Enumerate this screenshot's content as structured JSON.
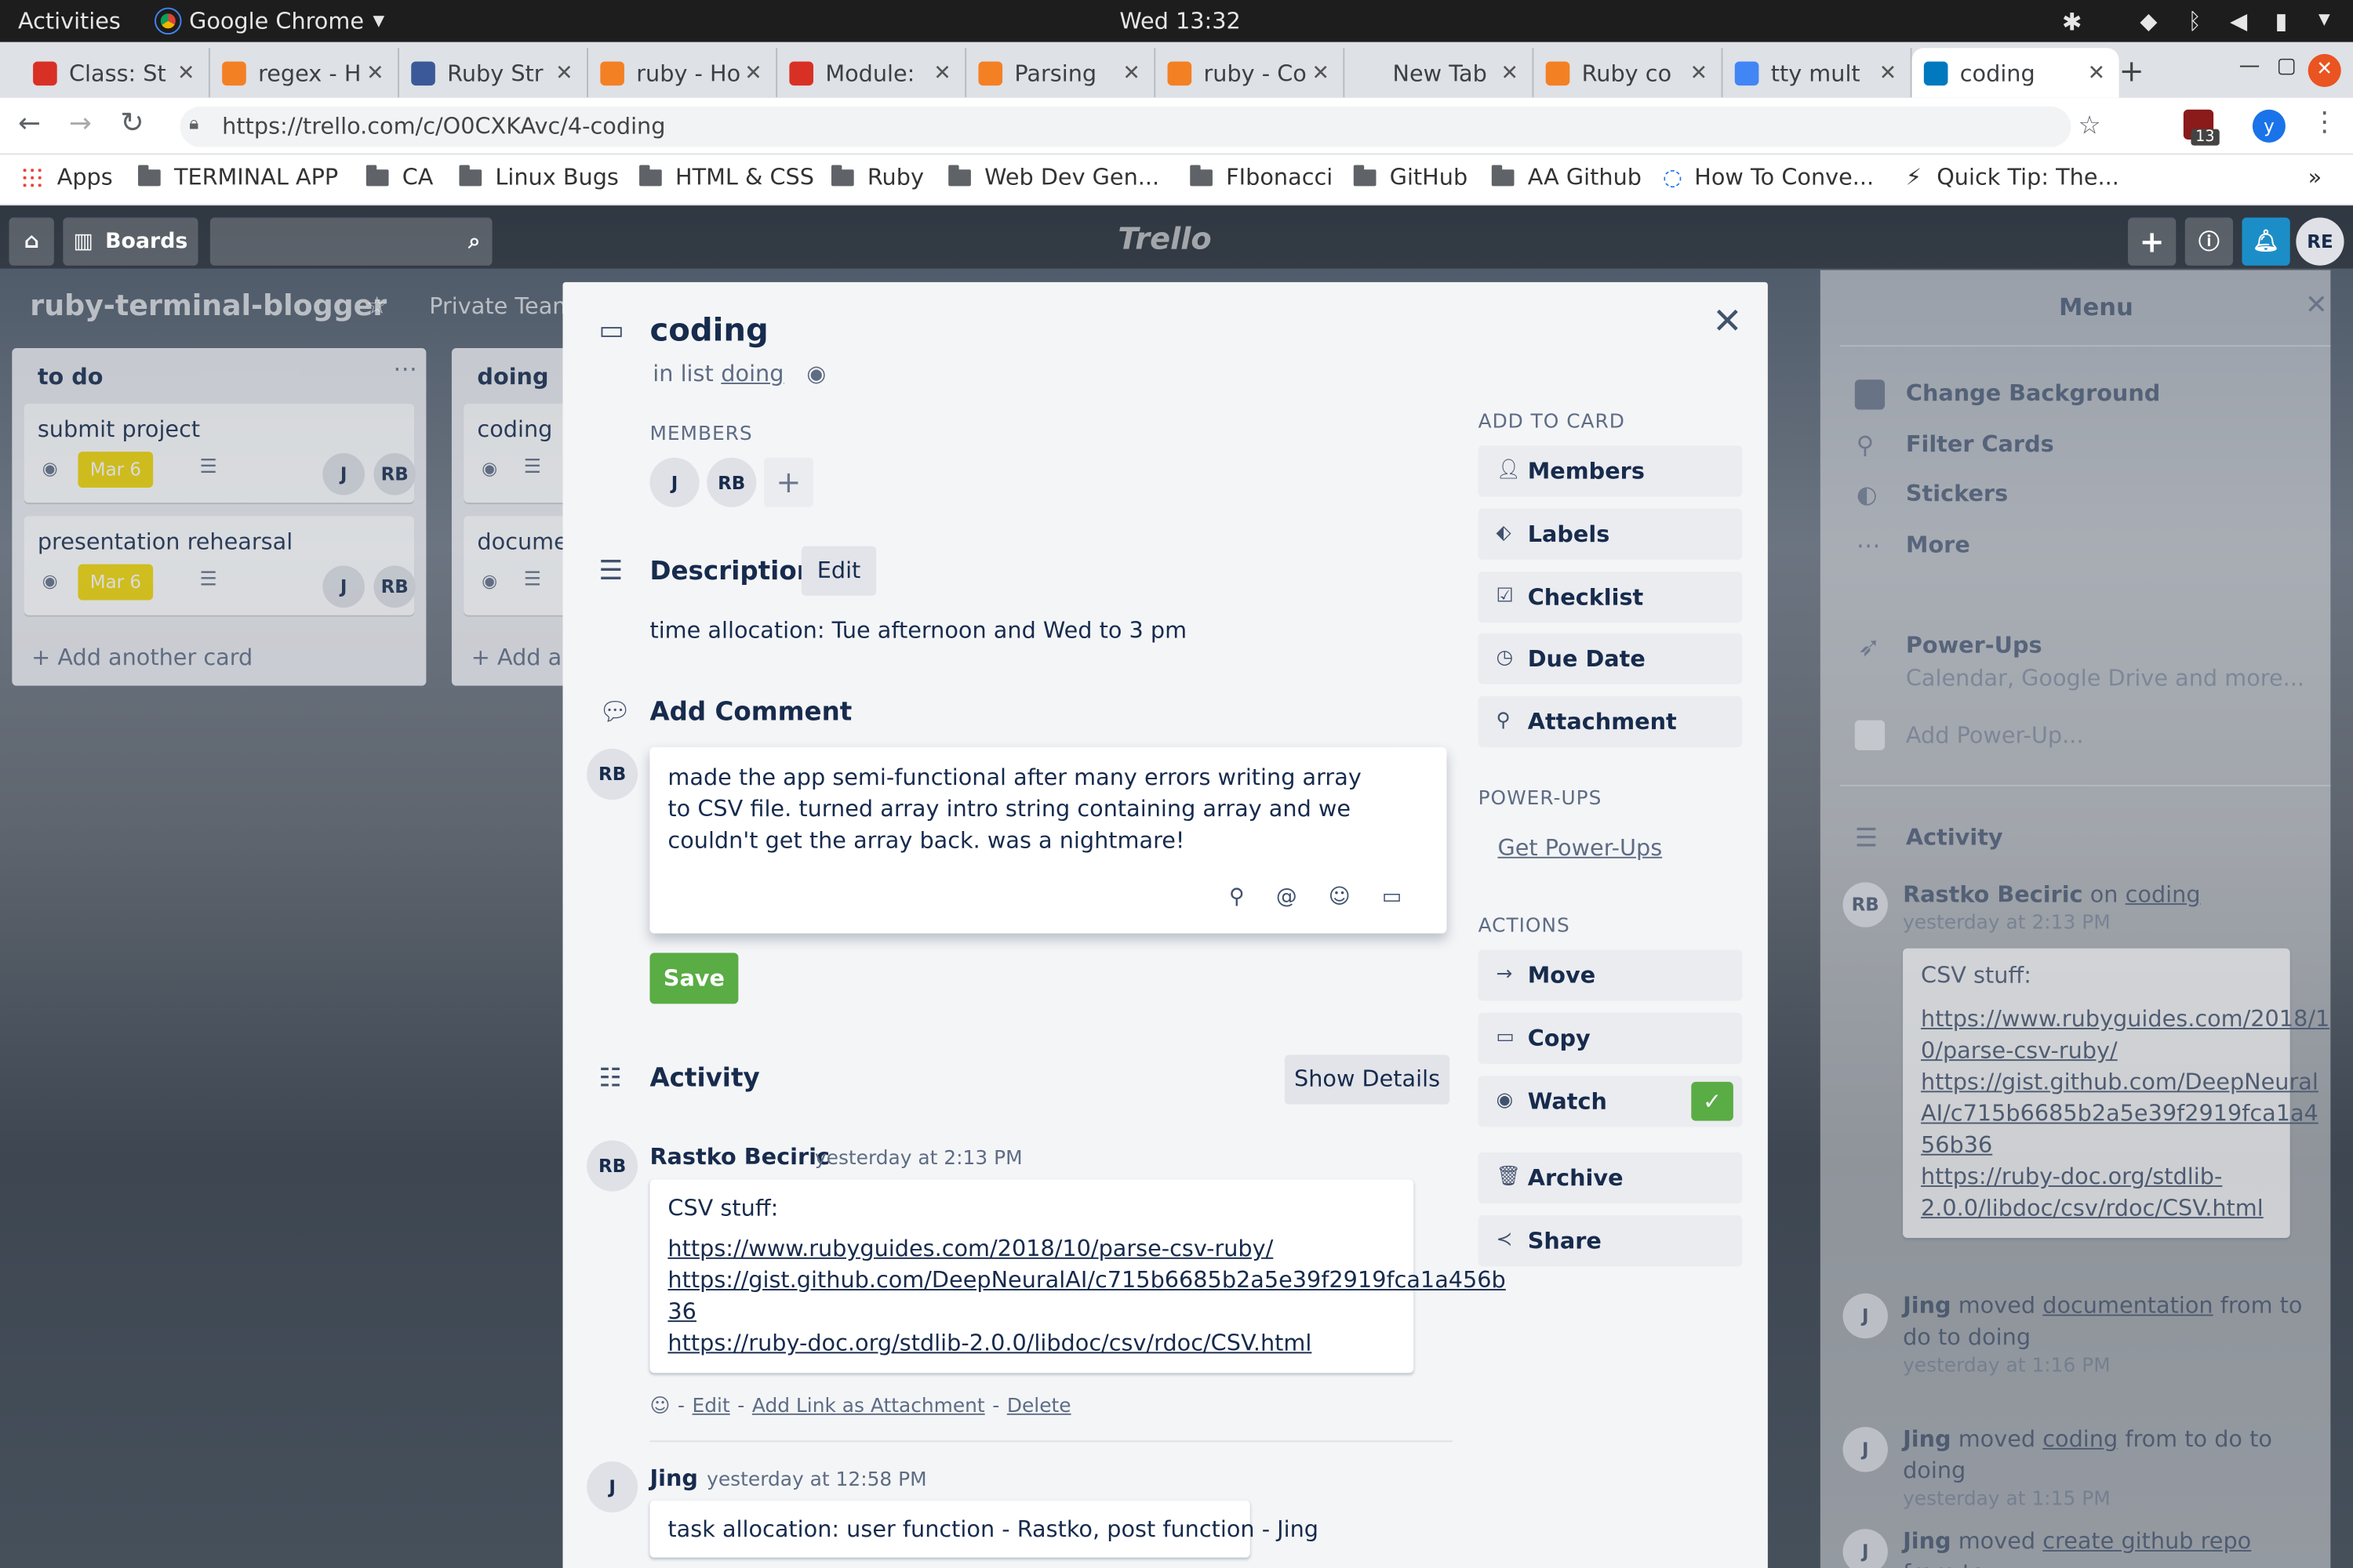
{
  "gnome": {
    "activities": "Activities",
    "app": "Google Chrome",
    "clock": "Wed 13:32"
  },
  "tabs": [
    {
      "label": "Class: St",
      "icon_color": "#d93025"
    },
    {
      "label": "regex - H",
      "icon_color": "#f48024"
    },
    {
      "label": "Ruby Str",
      "icon_color": "#3b5998"
    },
    {
      "label": "ruby - Ho",
      "icon_color": "#f48024"
    },
    {
      "label": "Module:",
      "icon_color": "#d93025"
    },
    {
      "label": "Parsing",
      "icon_color": "#f48024"
    },
    {
      "label": "ruby - Co",
      "icon_color": "#f48024"
    },
    {
      "label": "New Tab",
      "icon_color": "transparent"
    },
    {
      "label": "Ruby co",
      "icon_color": "#f48024"
    },
    {
      "label": "tty mult",
      "icon_color": "#4285f4"
    },
    {
      "label": "coding",
      "icon_color": "#0079bf"
    }
  ],
  "address": {
    "url": "https://trello.com/c/O0CXKAvc/4-coding",
    "badge": "13",
    "profile": "y"
  },
  "bookmarks": [
    "Apps",
    "TERMINAL APP",
    "CA",
    "Linux Bugs",
    "HTML & CSS",
    "Ruby",
    "Web Dev Gen...",
    "FIbonacci",
    "GitHub",
    "AA Github",
    "How To Conve...",
    "Quick Tip: The..."
  ],
  "trello": {
    "boards_label": "Boards",
    "logo": "Trello",
    "board_name": "ruby-terminal-blogger",
    "team": "Private Team",
    "user_initials": "RE",
    "lists": [
      {
        "title": "to do",
        "cards": [
          {
            "title": "submit project",
            "due": "Mar 6",
            "members": [
              "J",
              "RB"
            ]
          },
          {
            "title": "presentation rehearsal",
            "due": "Mar 6",
            "members": [
              "J",
              "RB"
            ]
          }
        ],
        "add": "+ Add another card"
      },
      {
        "title": "doing",
        "cards": [
          {
            "title": "coding"
          },
          {
            "title": "documen"
          }
        ],
        "add": "+ Add an"
      }
    ]
  },
  "card": {
    "title": "coding",
    "in_list_prefix": "in list",
    "list_name": "doing",
    "members_header": "MEMBERS",
    "members": [
      "J",
      "RB"
    ],
    "description_header": "Description",
    "edit_label": "Edit",
    "description": "time allocation: Tue afternoon and Wed to 3 pm",
    "add_comment_header": "Add Comment",
    "commenter": "RB",
    "comment_lines": [
      "made the app semi-functional after many errors writing array",
      "to CSV file. turned array intro string containing array and we",
      "couldn't get the array back. was a nightmare!"
    ],
    "save_label": "Save",
    "activity_header": "Activity",
    "show_details": "Show Details",
    "activity": [
      {
        "initials": "RB",
        "author": "Rastko Beciric",
        "time": "yesterday at 2:13 PM",
        "text": "CSV stuff:",
        "links": [
          "https://www.rubyguides.com/2018/10/parse-csv-ruby/",
          "https://gist.github.com/DeepNeuralAI/c715b6685b2a5e39f2919fca1a456b",
          "36",
          "https://ruby-doc.org/stdlib-2.0.0/libdoc/csv/rdoc/CSV.html"
        ],
        "actions": [
          "Edit",
          "Add Link as Attachment",
          "Delete"
        ]
      },
      {
        "initials": "J",
        "author": "Jing",
        "time": "yesterday at 12:58 PM",
        "text": "task allocation: user function - Rastko, post function - Jing"
      }
    ]
  },
  "sidebar": {
    "add_to_card": "ADD TO CARD",
    "add_buttons": [
      "Members",
      "Labels",
      "Checklist",
      "Due Date",
      "Attachment"
    ],
    "powerups_header": "POWER-UPS",
    "get_powerups": "Get Power-Ups",
    "actions_header": "ACTIONS",
    "action_buttons": [
      "Move",
      "Copy",
      "Watch",
      "Archive",
      "Share"
    ]
  },
  "menu": {
    "title": "Menu",
    "items": [
      "Change Background",
      "Filter Cards",
      "Stickers",
      "More"
    ],
    "powerups_title": "Power-Ups",
    "powerups_sub": "Calendar, Google Drive and more...",
    "add_powerup": "Add Power-Up...",
    "activity_title": "Activity",
    "feed": [
      {
        "initials": "RB",
        "actor": "Rastko Beciric",
        "mid": "on",
        "target": "coding",
        "rest": "",
        "time": "yesterday at 2:13 PM"
      },
      {
        "initials": "J",
        "actor": "Jing",
        "mid": "moved",
        "target": "documentation",
        "rest": "from to do to doing",
        "time": "yesterday at 1:16 PM"
      },
      {
        "initials": "J",
        "actor": "Jing",
        "mid": "moved",
        "target": "coding",
        "rest": "from to do to doing",
        "time": "yesterday at 1:15 PM"
      },
      {
        "initials": "J",
        "actor": "Jing",
        "mid": "moved",
        "target": "create github repo",
        "rest": "from to",
        "time": ""
      }
    ],
    "feed_links": [
      "CSV stuff:",
      "https://www.rubyguides.com/2018/1",
      "0/parse-csv-ruby/",
      "https://gist.github.com/DeepNeural",
      "AI/c715b6685b2a5e39f2919fca1a4",
      "56b36",
      "https://ruby-doc.org/stdlib-",
      "2.0.0/libdoc/csv/rdoc/CSV.html"
    ]
  }
}
